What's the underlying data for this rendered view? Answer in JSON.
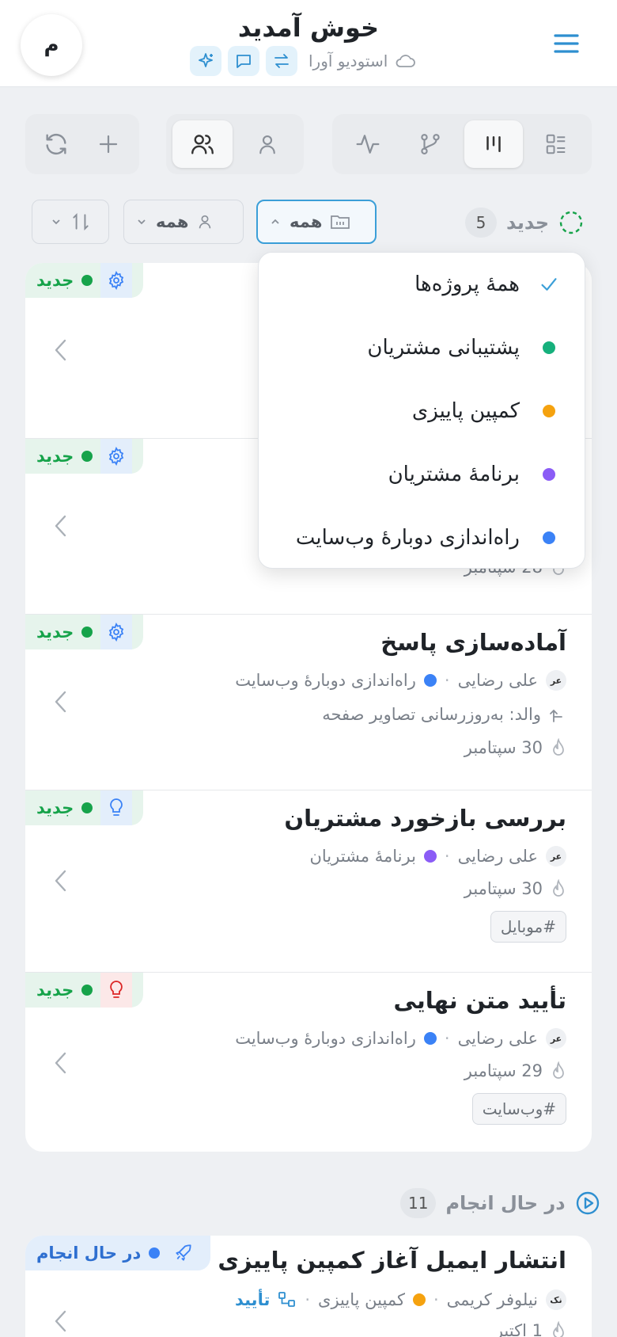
{
  "header": {
    "title": "خوش آمدید",
    "avatar_letter": "م",
    "studio_name": "استودیو آورا",
    "accent_color": "#2e8fd0"
  },
  "filters": {
    "project_filter": "همه",
    "assignee_filter": "همه"
  },
  "sections": {
    "new": {
      "label": "جدید",
      "count": "5"
    },
    "in_progress": {
      "label": "در حال انجام",
      "count": "11"
    }
  },
  "dropdown": {
    "items": [
      {
        "label": "همهٔ پروژه‌ها",
        "selected": true
      },
      {
        "label": "پشتیبانی مشتریان",
        "color": "#16b07c"
      },
      {
        "label": "کمپین پاییزی",
        "color": "#f5a20f"
      },
      {
        "label": "برنامهٔ مشتریان",
        "color": "#8b5cf6"
      },
      {
        "label": "راه‌اندازی دوبارهٔ وب‌سایت",
        "color": "#3b82f6"
      }
    ]
  },
  "cards": [
    {
      "status": "جدید",
      "icon": "gear-icon"
    },
    {
      "status": "جدید",
      "icon": "gear-icon",
      "due": "28 سپتامبر"
    },
    {
      "status": "جدید",
      "icon": "gear-icon",
      "title": "آماده‌سازی پاسخ",
      "initials": "عر",
      "assignee": "علی رضایی",
      "project": "راه‌اندازی دوبارهٔ وب‌سایت",
      "project_color": "#3b82f6",
      "parent": "والد: به‌روزرسانی تصاویر صفحه",
      "due": "30 سپتامبر"
    },
    {
      "status": "جدید",
      "icon": "lightbulb-icon",
      "title": "بررسی بازخورد مشتریان",
      "initials": "عر",
      "assignee": "علی رضایی",
      "project": "برنامهٔ مشتریان",
      "project_color": "#8b5cf6",
      "due": "30 سپتامبر",
      "tag": "#موبایل"
    },
    {
      "status": "جدید",
      "icon": "lightbulb-icon",
      "title": "تأیید متن نهایی",
      "initials": "عر",
      "assignee": "علی رضایی",
      "project": "راه‌اندازی دوبارهٔ وب‌سایت",
      "project_color": "#3b82f6",
      "due": "29 سپتامبر",
      "tag": "#وب‌سایت"
    }
  ],
  "in_progress_card": {
    "status": "در حال انجام",
    "icon": "rocket-icon",
    "title": "انتشار ایمیل آغاز کمپین پاییزی",
    "initials": "نک",
    "assignee": "نیلوفر کریمی",
    "project": "کمپین پاییزی",
    "project_color": "#f5a20f",
    "approval": "تأیید",
    "due": "1 اکتبر"
  }
}
